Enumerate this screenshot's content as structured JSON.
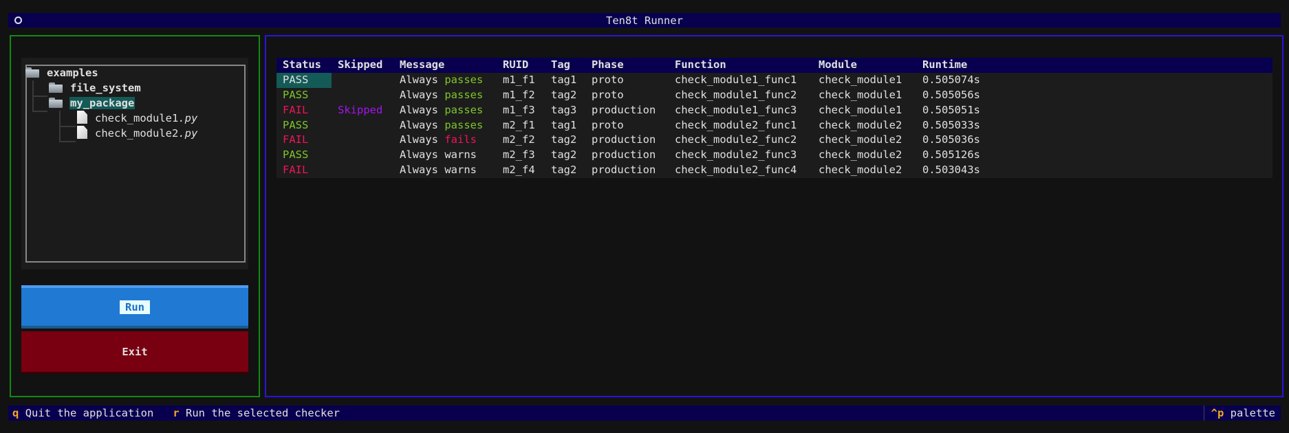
{
  "app": {
    "title": "Ten8t Runner"
  },
  "tree": {
    "root": "examples",
    "children": [
      {
        "label": "file_system",
        "type": "folder"
      },
      {
        "label": "my_package",
        "type": "folder",
        "selected": true
      }
    ],
    "files": [
      {
        "name": "check_module1",
        "ext": ".py"
      },
      {
        "name": "check_module2",
        "ext": ".py"
      }
    ]
  },
  "buttons": {
    "run": "Run",
    "exit": "Exit"
  },
  "table": {
    "columns": [
      "Status",
      "Skipped",
      "Message",
      "RUID",
      "Tag",
      "Phase",
      "Function",
      "Module",
      "Runtime"
    ],
    "rows": [
      {
        "status": "PASS",
        "skipped": "",
        "msg1": "Always",
        "msg2": "passes",
        "msg2_kind": "pass",
        "ruid": "m1_f1",
        "tag": "tag1",
        "phase": "proto",
        "function": "check_module1_func1",
        "module": "check_module1",
        "runtime": "0.505074s"
      },
      {
        "status": "PASS",
        "skipped": "",
        "msg1": "Always",
        "msg2": "passes",
        "msg2_kind": "pass",
        "ruid": "m1_f2",
        "tag": "tag2",
        "phase": "proto",
        "function": "check_module1_func2",
        "module": "check_module1",
        "runtime": "0.505056s"
      },
      {
        "status": "FAIL",
        "skipped": "Skipped",
        "msg1": "Always",
        "msg2": "passes",
        "msg2_kind": "pass",
        "ruid": "m1_f3",
        "tag": "tag3",
        "phase": "production",
        "function": "check_module1_func3",
        "module": "check_module1",
        "runtime": "0.505051s"
      },
      {
        "status": "PASS",
        "skipped": "",
        "msg1": "Always",
        "msg2": "passes",
        "msg2_kind": "pass",
        "ruid": "m2_f1",
        "tag": "tag1",
        "phase": "proto",
        "function": "check_module2_func1",
        "module": "check_module2",
        "runtime": "0.505033s"
      },
      {
        "status": "FAIL",
        "skipped": "",
        "msg1": "Always",
        "msg2": "fails",
        "msg2_kind": "fail",
        "ruid": "m2_f2",
        "tag": "tag2",
        "phase": "production",
        "function": "check_module2_func2",
        "module": "check_module2",
        "runtime": "0.505036s"
      },
      {
        "status": "PASS",
        "skipped": "",
        "msg1": "Always",
        "msg2": "warns",
        "msg2_kind": "plain",
        "ruid": "m2_f3",
        "tag": "tag2",
        "phase": "production",
        "function": "check_module2_func3",
        "module": "check_module2",
        "runtime": "0.505126s"
      },
      {
        "status": "FAIL",
        "skipped": "",
        "msg1": "Always",
        "msg2": "warns",
        "msg2_kind": "plain",
        "ruid": "m2_f4",
        "tag": "tag2",
        "phase": "production",
        "function": "check_module2_func4",
        "module": "check_module2",
        "runtime": "0.503043s"
      }
    ]
  },
  "footer": {
    "bindings": [
      {
        "key": "q",
        "desc": "Quit the application"
      },
      {
        "key": "r",
        "desc": "Run the selected checker"
      }
    ],
    "palette": {
      "key": "^p",
      "desc": "palette"
    }
  },
  "colors": {
    "pass": "#7ec62a",
    "fail": "#ee1658",
    "skipped": "#a414f0",
    "header": "#08004f",
    "run": "#2079d2",
    "exit": "#780010"
  }
}
